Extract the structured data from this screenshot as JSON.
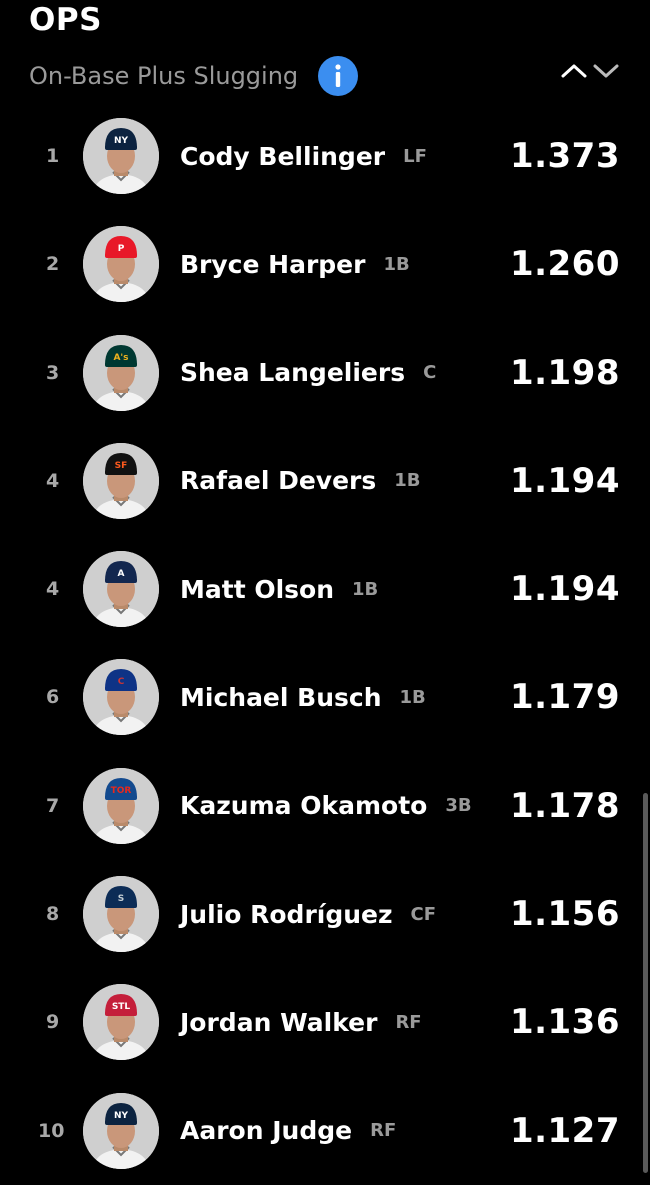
{
  "header": {
    "title": "OPS",
    "subtitle": "On-Base Plus Slugging",
    "info_icon": "info-icon",
    "sort_icons": [
      "chevron-up-icon",
      "chevron-down-icon"
    ]
  },
  "colors": {
    "background": "#000000",
    "info_blue": "#3b8ef0",
    "secondary_text": "#9a9a9a"
  },
  "players": [
    {
      "rank": "1",
      "name": "Cody Bellinger",
      "pos": "LF",
      "value": "1.373",
      "cap_color": "#0c2340",
      "logo": "NY",
      "logo_color": "#ffffff"
    },
    {
      "rank": "2",
      "name": "Bryce Harper",
      "pos": "1B",
      "value": "1.260",
      "cap_color": "#e81828",
      "logo": "P",
      "logo_color": "#ffffff"
    },
    {
      "rank": "3",
      "name": "Shea Langeliers",
      "pos": "C",
      "value": "1.198",
      "cap_color": "#003831",
      "logo": "A's",
      "logo_color": "#efb21e"
    },
    {
      "rank": "4",
      "name": "Rafael Devers",
      "pos": "1B",
      "value": "1.194",
      "cap_color": "#111111",
      "logo": "SF",
      "logo_color": "#fd5a1e"
    },
    {
      "rank": "4",
      "name": "Matt Olson",
      "pos": "1B",
      "value": "1.194",
      "cap_color": "#13274f",
      "logo": "A",
      "logo_color": "#ffffff"
    },
    {
      "rank": "6",
      "name": "Michael Busch",
      "pos": "1B",
      "value": "1.179",
      "cap_color": "#0e3386",
      "logo": "C",
      "logo_color": "#cc3433"
    },
    {
      "rank": "7",
      "name": "Kazuma Okamoto",
      "pos": "3B",
      "value": "1.178",
      "cap_color": "#134a8e",
      "logo": "TOR",
      "logo_color": "#e8291c"
    },
    {
      "rank": "8",
      "name": "Julio Rodríguez",
      "pos": "CF",
      "value": "1.156",
      "cap_color": "#0c2c56",
      "logo": "S",
      "logo_color": "#c4ced4"
    },
    {
      "rank": "9",
      "name": "Jordan Walker",
      "pos": "RF",
      "value": "1.136",
      "cap_color": "#c41e3a",
      "logo": "STL",
      "logo_color": "#ffffff"
    },
    {
      "rank": "10",
      "name": "Aaron Judge",
      "pos": "RF",
      "value": "1.127",
      "cap_color": "#0c2340",
      "logo": "NY",
      "logo_color": "#ffffff"
    }
  ]
}
